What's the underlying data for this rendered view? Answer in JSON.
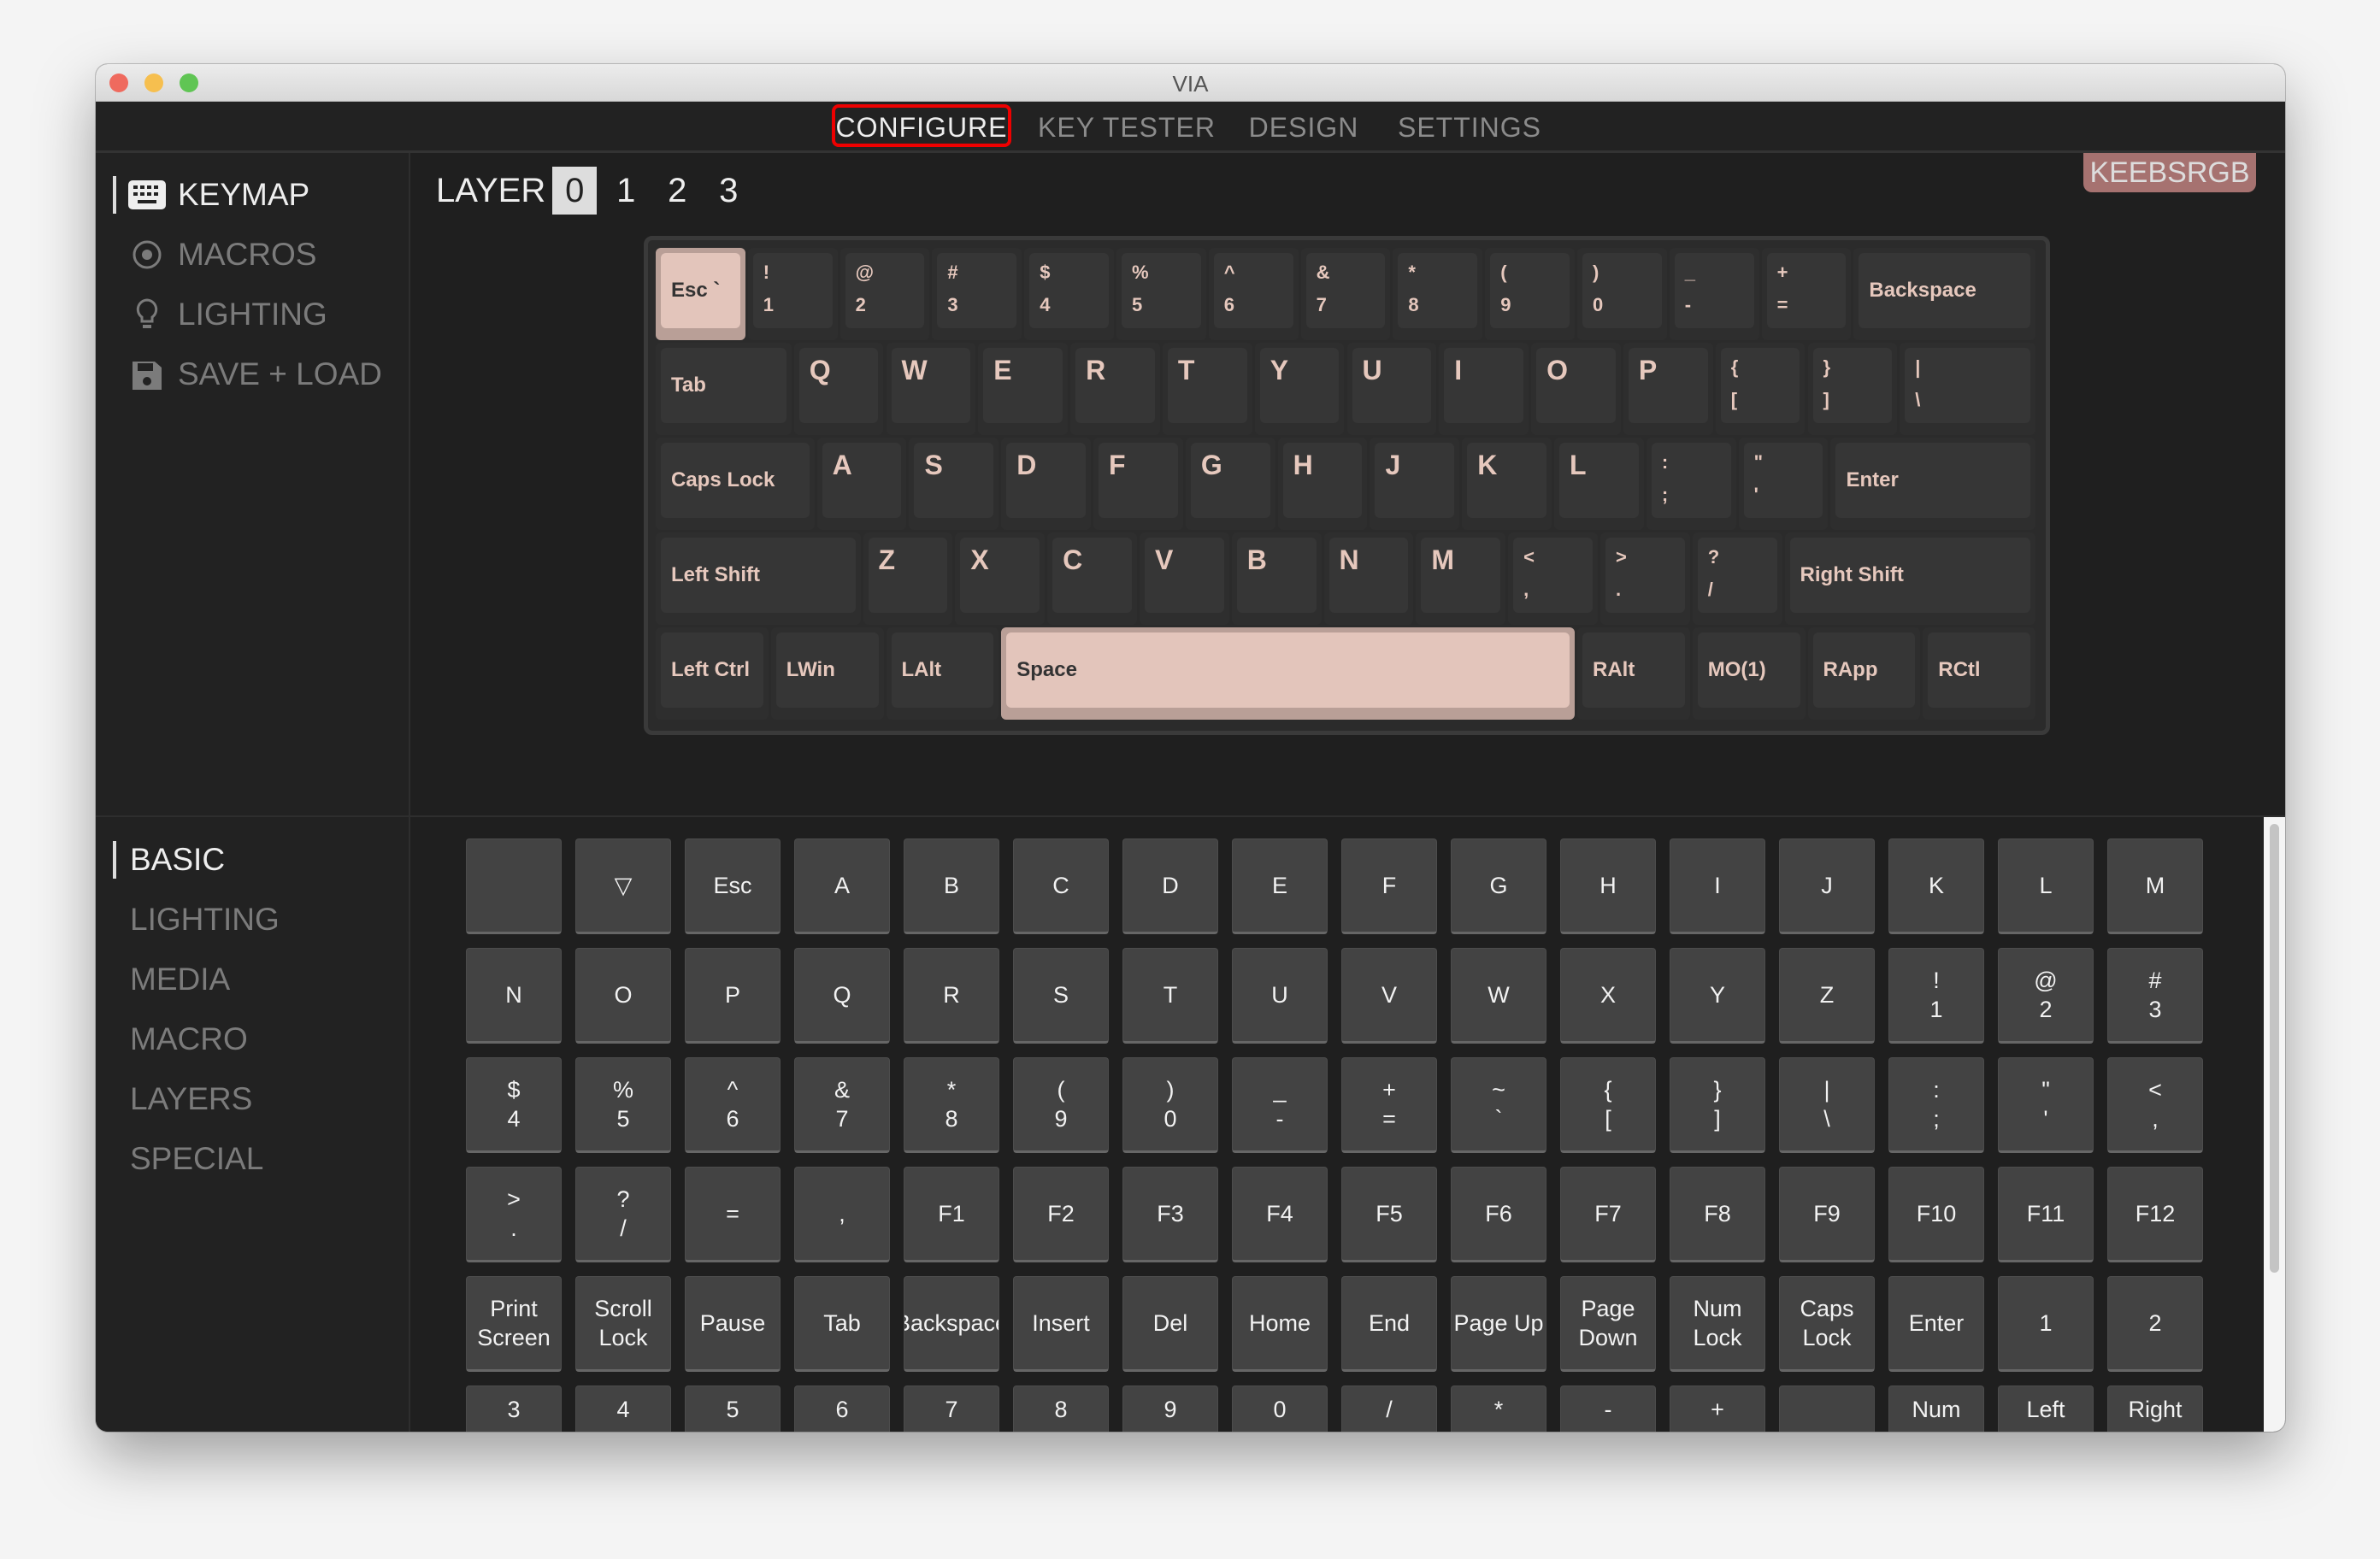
{
  "window": {
    "title": "VIA"
  },
  "nav": {
    "tabs": [
      {
        "label": "CONFIGURE",
        "active": true
      },
      {
        "label": "KEY TESTER"
      },
      {
        "label": "DESIGN"
      },
      {
        "label": "SETTINGS"
      }
    ]
  },
  "sidebar_top": [
    {
      "label": "KEYMAP",
      "icon": "keyboard-icon",
      "active": true
    },
    {
      "label": "MACROS",
      "icon": "record-icon"
    },
    {
      "label": "LIGHTING",
      "icon": "lightbulb-icon"
    },
    {
      "label": "SAVE + LOAD",
      "icon": "floppy-disk-icon"
    }
  ],
  "layer": {
    "label": "LAYER",
    "options": [
      "0",
      "1",
      "2",
      "3"
    ],
    "selected": "0"
  },
  "device_badge": "KEEBSRGB",
  "colors": {
    "accent": "#e3c5bb",
    "badge": "#a67270",
    "highlight": "#ee0000"
  },
  "keyboard": [
    [
      {
        "t": "Esc `",
        "w": 1,
        "sel": true
      },
      {
        "t": "!",
        "b": "1"
      },
      {
        "t": "@",
        "b": "2"
      },
      {
        "t": "#",
        "b": "3"
      },
      {
        "t": "$",
        "b": "4"
      },
      {
        "t": "%",
        "b": "5"
      },
      {
        "t": "^",
        "b": "6"
      },
      {
        "t": "&",
        "b": "7"
      },
      {
        "t": "*",
        "b": "8"
      },
      {
        "t": "(",
        "b": "9"
      },
      {
        "t": ")",
        "b": "0"
      },
      {
        "t": "_",
        "b": "-"
      },
      {
        "t": "+",
        "b": "="
      },
      {
        "t": "Backspace",
        "w": 2
      }
    ],
    [
      {
        "t": "Tab",
        "w": 1.5
      },
      {
        "L": "Q"
      },
      {
        "L": "W"
      },
      {
        "L": "E"
      },
      {
        "L": "R"
      },
      {
        "L": "T"
      },
      {
        "L": "Y"
      },
      {
        "L": "U"
      },
      {
        "L": "I"
      },
      {
        "L": "O"
      },
      {
        "L": "P"
      },
      {
        "t": "{",
        "b": "["
      },
      {
        "t": "}",
        "b": "]"
      },
      {
        "t": "|",
        "b": "\\",
        "w": 1.5
      }
    ],
    [
      {
        "t": "Caps Lock",
        "w": 1.75
      },
      {
        "L": "A"
      },
      {
        "L": "S"
      },
      {
        "L": "D"
      },
      {
        "L": "F"
      },
      {
        "L": "G"
      },
      {
        "L": "H"
      },
      {
        "L": "J"
      },
      {
        "L": "K"
      },
      {
        "L": "L"
      },
      {
        "t": ":",
        "b": ";"
      },
      {
        "t": "\"",
        "b": "'"
      },
      {
        "t": "Enter",
        "w": 2.25
      }
    ],
    [
      {
        "t": "Left Shift",
        "w": 2.25
      },
      {
        "L": "Z"
      },
      {
        "L": "X"
      },
      {
        "L": "C"
      },
      {
        "L": "V"
      },
      {
        "L": "B"
      },
      {
        "L": "N"
      },
      {
        "L": "M"
      },
      {
        "t": "<",
        "b": ","
      },
      {
        "t": ">",
        "b": "."
      },
      {
        "t": "?",
        "b": "/"
      },
      {
        "t": "Right Shift",
        "w": 2.75
      }
    ],
    [
      {
        "t": "Left Ctrl",
        "w": 1.25
      },
      {
        "t": "LWin",
        "w": 1.25
      },
      {
        "t": "LAlt",
        "w": 1.25
      },
      {
        "t": "Space",
        "w": 6.25,
        "sel": true
      },
      {
        "t": "RAlt",
        "w": 1.25
      },
      {
        "t": "MO(1)",
        "w": 1.25
      },
      {
        "t": "RApp",
        "w": 1.25
      },
      {
        "t": "RCtl",
        "w": 1.25
      }
    ]
  ],
  "sidebar_bottom": [
    {
      "label": "BASIC",
      "active": true
    },
    {
      "label": "LIGHTING"
    },
    {
      "label": "MEDIA"
    },
    {
      "label": "MACRO"
    },
    {
      "label": "LAYERS"
    },
    {
      "label": "SPECIAL"
    }
  ],
  "keycodes": [
    [
      "",
      "▽",
      "Esc",
      "A",
      "B",
      "C",
      "D",
      "E",
      "F",
      "G",
      "H",
      "I",
      "J",
      "K",
      "L",
      "M"
    ],
    [
      "N",
      "O",
      "P",
      "Q",
      "R",
      "S",
      "T",
      "U",
      "V",
      "W",
      "X",
      "Y",
      "Z",
      "!\n1",
      "@\n2",
      "#\n3"
    ],
    [
      "$\n4",
      "%\n5",
      "^\n6",
      "&\n7",
      "*\n8",
      "(\n9",
      ")\n0",
      "_\n-",
      "+\n=",
      "~\n`",
      "{\n[",
      "}\n]",
      "|\n\\",
      ":\n;",
      "\"\n'",
      "<\n,"
    ],
    [
      ">\n.",
      "?\n/",
      "=",
      ",",
      "F1",
      "F2",
      "F3",
      "F4",
      "F5",
      "F6",
      "F7",
      "F8",
      "F9",
      "F10",
      "F11",
      "F12"
    ],
    [
      "Print\nScreen",
      "Scroll\nLock",
      "Pause",
      "Tab",
      "Backspace",
      "Insert",
      "Del",
      "Home",
      "End",
      "Page Up",
      "Page\nDown",
      "Num\nLock",
      "Caps\nLock",
      "Enter",
      "1",
      "2"
    ],
    [
      "3",
      "4",
      "5",
      "6",
      "7",
      "8",
      "9",
      "0",
      "/",
      "*",
      "-",
      "+",
      "",
      "Num",
      "Left",
      "Right"
    ]
  ]
}
